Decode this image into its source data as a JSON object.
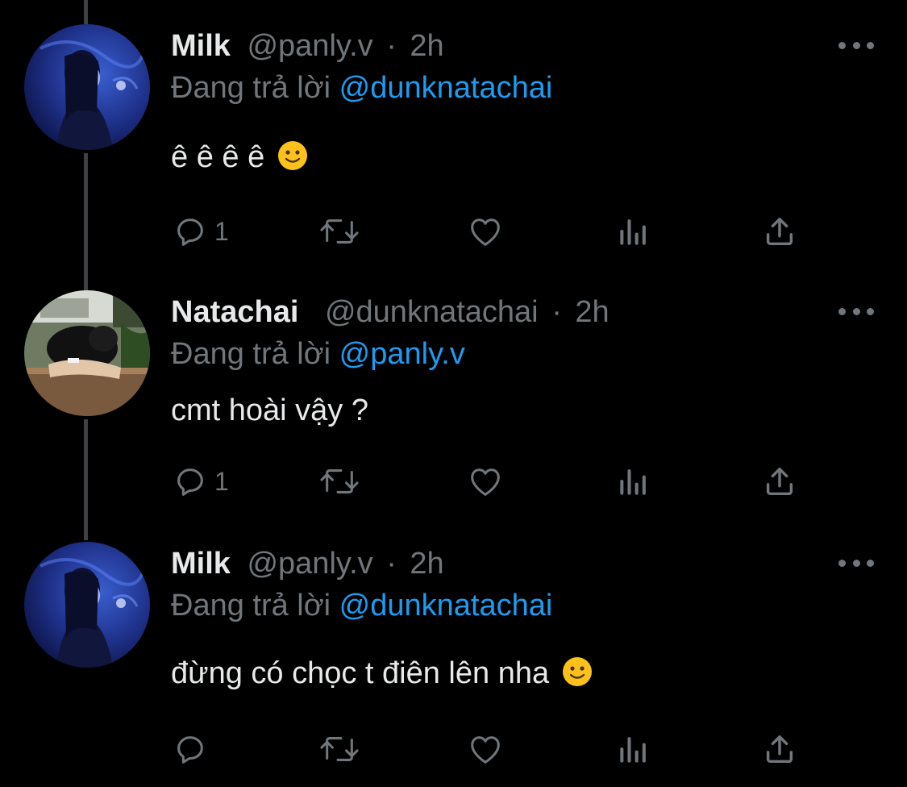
{
  "thread": {
    "reply_prefix": "Đang trả lời"
  },
  "tweets": [
    {
      "name": "Milk",
      "handle": "@panly.v",
      "separator": "·",
      "time": "2h",
      "reply_to": "@dunknatachai",
      "text": "ê ê ê ê",
      "text_emoji": "slightly-smiling-face",
      "reply_count": "1",
      "avatar": "girl-in-blue-aquarium-photo"
    },
    {
      "name": "Natachai",
      "handle": "@dunknatachai",
      "separator": "·",
      "time": "2h",
      "reply_to": "@panly.v",
      "text": "cmt hoài vậy ?",
      "reply_count": "1",
      "avatar": "person-leaning-on-table-photo"
    },
    {
      "name": "Milk",
      "handle": "@panly.v",
      "separator": "·",
      "time": "2h",
      "reply_to": "@dunknatachai",
      "text": "đừng có chọc t điên lên nha",
      "text_emoji": "slightly-smiling-face",
      "reply_count": "",
      "avatar": "girl-in-blue-aquarium-photo"
    }
  ],
  "icons": {
    "reply": "reply-icon",
    "retweet": "retweet-icon",
    "like": "heart-icon",
    "views": "views-icon",
    "share": "share-icon",
    "more": "more-icon"
  },
  "colors": {
    "background": "#000000",
    "text": "#e7e9ea",
    "secondary": "#71767b",
    "link": "#1d9bf0",
    "thread_line": "#3e4144"
  }
}
